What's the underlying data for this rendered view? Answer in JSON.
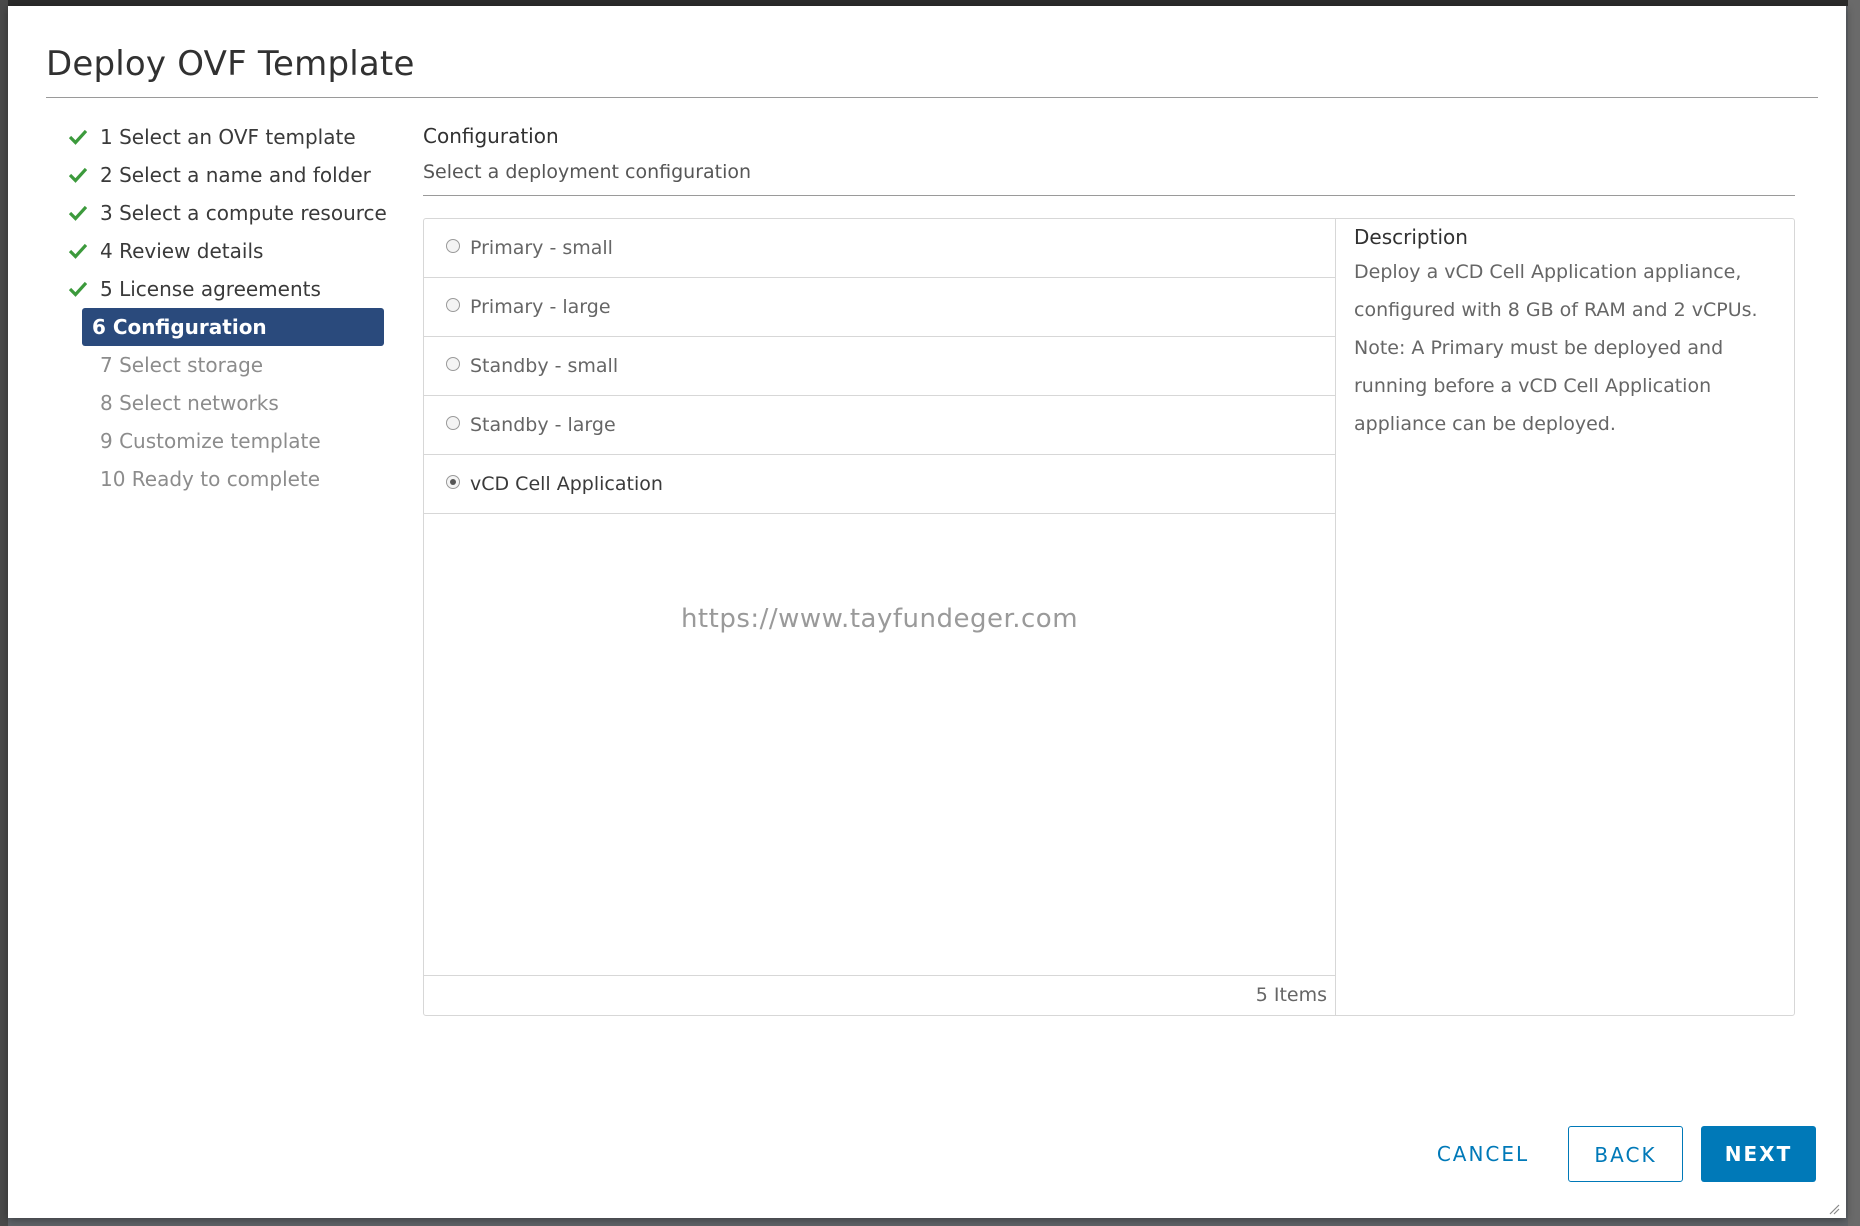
{
  "modal": {
    "title": "Deploy OVF Template"
  },
  "steps": [
    {
      "label": "1 Select an OVF template",
      "state": "done"
    },
    {
      "label": "2 Select a name and folder",
      "state": "done"
    },
    {
      "label": "3 Select a compute resource",
      "state": "done"
    },
    {
      "label": "4 Review details",
      "state": "done"
    },
    {
      "label": "5 License agreements",
      "state": "done"
    },
    {
      "label": "6 Configuration",
      "state": "active"
    },
    {
      "label": "7 Select storage",
      "state": "pending"
    },
    {
      "label": "8 Select networks",
      "state": "pending"
    },
    {
      "label": "9 Customize template",
      "state": "pending"
    },
    {
      "label": "10 Ready to complete",
      "state": "pending"
    }
  ],
  "content": {
    "title": "Configuration",
    "subtitle": "Select a deployment configuration",
    "options": [
      {
        "label": "Primary - small",
        "selected": false
      },
      {
        "label": "Primary - large",
        "selected": false
      },
      {
        "label": "Standby - small",
        "selected": false
      },
      {
        "label": "Standby - large",
        "selected": false
      },
      {
        "label": "vCD Cell Application",
        "selected": true
      }
    ],
    "watermark": "https://www.tayfundeger.com",
    "items_count": "5 Items",
    "description_title": "Description",
    "description_text": "Deploy a vCD Cell Application appliance, configured with 8 GB of RAM and 2 vCPUs. Note: A Primary must be deployed and running before a vCD Cell Application appliance can be deployed."
  },
  "buttons": {
    "cancel": "CANCEL",
    "back": "BACK",
    "next": "NEXT"
  },
  "icons": {
    "check": "check-icon",
    "check_color": "#3c9a3c"
  },
  "colors": {
    "primary": "#0079b8",
    "active_step": "#2a4a7c"
  }
}
